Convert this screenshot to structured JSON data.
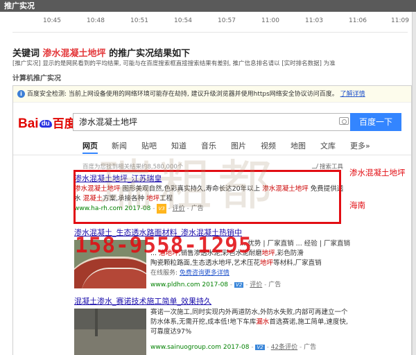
{
  "topbar": {
    "title": "推广实况"
  },
  "timeline": {
    "ticks": [
      "10:45",
      "10:48",
      "10:51",
      "10:54",
      "10:57",
      "11:00",
      "11:03",
      "11:06",
      "11:09"
    ]
  },
  "report": {
    "title_prefix": "关键词",
    "keyword": "渗水混凝土地坪",
    "title_suffix": "的推广实况结果如下",
    "note": "[推广实况] 显示的是网民看到的平均结果, 可能与在百度搜索框直接搜索结果有差别, 推广信息排名请以 [实时排名数据] 为准",
    "section_label": "计算机推广实况"
  },
  "security_bar": {
    "icon": "info-icon",
    "text": "百度安全检测: 当前上网设备使用的网络环境可能存在劫持, 建议升级浏览器并使用https网络安全协议访问百度。",
    "link": "了解详情"
  },
  "baidu": {
    "logo_left": "Bai",
    "logo_paw": "du",
    "logo_cn": "百度",
    "query": "渗水混凝土地坪",
    "button": "百度一下",
    "tabs": [
      "网页",
      "新闻",
      "贴吧",
      "知道",
      "音乐",
      "图片",
      "视频",
      "地图",
      "文库",
      "更多»"
    ],
    "result_count": "百度为您找到相关结果约8,580,000个",
    "tools": "搜索工具"
  },
  "result1": {
    "title": "渗水混凝土地坪_江苏瑞皇",
    "line1_a": "渗水混凝土地坪",
    "line1_b": " 图形美观自然,色彩真实持久,寿命长达20年以上 ",
    "line1_c": "渗水混凝土地坪",
    "line1_d": " 免费提供透",
    "line2_a": "水",
    "line2_b": "混凝土",
    "line2_c": "方案,承接各种",
    "line2_d": "地坪",
    "line2_e": "工程",
    "url": "www.ha-rh.com",
    "date": "2017-08",
    "badge": "V3",
    "eval": "评价",
    "ad": "广告"
  },
  "result2": {
    "title": "渗水混凝土_生态透水路面材料_渗水混凝土热销中",
    "line1": "... 优势 | 厂家直销 ... 经验 | 厂家直销",
    "line2_a": "... ",
    "line2_b": "洛地坪",
    "line2_c": ",销售渗透水泥,彩色水泥耐磨",
    "line2_d": "地坪",
    "line2_e": ",彩色防滑",
    "line3_a": "陶瓷颗粒路面,生态透水地坪,艺术压花",
    "line3_b": "地坪",
    "line3_c": "等材料,厂家直销",
    "line4_a": "在线服务: ",
    "line4_b": "免费咨询更多详情",
    "url": "www.pldhn.com",
    "date": "2017-08",
    "badge": "V2",
    "eval": "评价",
    "ad": "广告"
  },
  "result3": {
    "title": "混凝土渗水_赛诺技术施工简单_效果持久",
    "line1": "赛诺一次施工,同时实现内外两道防水,外防水失败,内部可再建立一个",
    "line2": "防水体系,无需开挖,成本低!地下车库",
    "line2_hl": "漏水",
    "line2_end": "首选赛诺,施工简单,速度快,",
    "line3": "可靠度达97%",
    "url": "www.sainuogroup.com",
    "date": "2017-08",
    "badge": "V2",
    "eval": "42条评价",
    "ad": "广告"
  },
  "annotations": {
    "side_label_1": "渗水混凝土地坪",
    "side_label_2": "海南",
    "phone": "158-9558-1295",
    "watermark": "瑞粗都"
  },
  "colors": {
    "accent_red": "#e20d13",
    "baidu_blue": "#3385ff",
    "link_blue": "#1a0dab",
    "url_green": "#008000"
  }
}
